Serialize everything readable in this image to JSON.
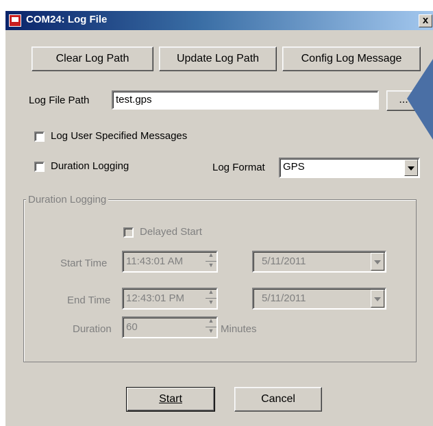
{
  "window": {
    "title": "COM24: Log File",
    "close_label": "x"
  },
  "toolbar": {
    "clear_label": "Clear Log Path",
    "update_label": "Update Log Path",
    "config_label": "Config Log Message"
  },
  "log_path": {
    "label": "Log File Path",
    "value": "test.gps",
    "browse_label": "..."
  },
  "options": {
    "user_msgs_label": "Log User Specified Messages",
    "user_msgs_checked": false,
    "duration_label": "Duration Logging",
    "duration_checked": false,
    "format_label": "Log Format",
    "format_value": "GPS"
  },
  "duration_group": {
    "legend": "Duration Logging",
    "delayed_start_label": "Delayed Start",
    "start_time_label": "Start Time",
    "start_time_value": "11:43:01 AM",
    "start_date_value": "5/11/2011",
    "end_time_label": "End Time",
    "end_time_value": "12:43:01 PM",
    "end_date_value": "5/11/2011",
    "duration_label": "Duration",
    "duration_value": "60",
    "duration_unit": "Minutes"
  },
  "footer": {
    "start_label": "Start",
    "cancel_label": "Cancel"
  },
  "colors": {
    "title_gradient_start": "#0a246a",
    "title_gradient_end": "#a6caf0",
    "dialog_bg": "#d4d0c8",
    "pointer_arrow": "#4a6fa5"
  }
}
